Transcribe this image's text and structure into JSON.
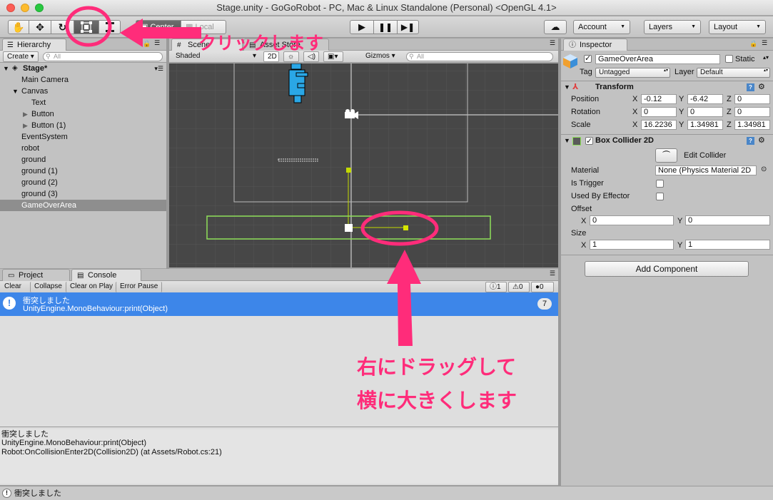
{
  "window": {
    "title": "Stage.unity - GoGoRobot - PC, Mac & Linux Standalone (Personal) <OpenGL 4.1>"
  },
  "toolbar": {
    "pivot_center": "Center",
    "pivot_local": "Local",
    "account": "Account",
    "layers": "Layers",
    "layout": "Layout"
  },
  "hierarchy": {
    "tab": "Hierarchy",
    "create": "Create",
    "search_placeholder": "All",
    "scene_name": "Stage*",
    "items": [
      {
        "label": "Main Camera"
      },
      {
        "label": "Canvas"
      },
      {
        "label": "Text"
      },
      {
        "label": "Button"
      },
      {
        "label": "Button (1)"
      },
      {
        "label": "EventSystem"
      },
      {
        "label": "robot"
      },
      {
        "label": "ground"
      },
      {
        "label": "ground (1)"
      },
      {
        "label": "ground (2)"
      },
      {
        "label": "ground (3)"
      },
      {
        "label": "GameOverArea"
      }
    ]
  },
  "scene": {
    "tab_scene": "Scene",
    "tab_store": "Asset Store",
    "shading": "Shaded",
    "mode_2d": "2D",
    "gizmos": "Gizmos",
    "search_placeholder": "All"
  },
  "console": {
    "tab_project": "Project",
    "tab_console": "Console",
    "clear": "Clear",
    "collapse": "Collapse",
    "clear_on_play": "Clear on Play",
    "error_pause": "Error Pause",
    "count_info": "1",
    "count_warn": "0",
    "count_error": "0",
    "entry_line1": "衝突しました",
    "entry_line2": "UnityEngine.MonoBehaviour:print(Object)",
    "entry_count": "7",
    "detail_line1": "衝突しました",
    "detail_line2": "UnityEngine.MonoBehaviour:print(Object)",
    "detail_line3": "Robot:OnCollisionEnter2D(Collision2D) (at Assets/Robot.cs:21)"
  },
  "inspector": {
    "tab": "Inspector",
    "object_name": "GameOverArea",
    "static_label": "Static",
    "tag_label": "Tag",
    "tag_value": "Untagged",
    "layer_label": "Layer",
    "layer_value": "Default",
    "transform": {
      "title": "Transform",
      "position_label": "Position",
      "rotation_label": "Rotation",
      "scale_label": "Scale",
      "x": "X",
      "y": "Y",
      "z": "Z",
      "position": [
        "-0.12",
        "-6.42",
        "0"
      ],
      "rotation": [
        "0",
        "0",
        "0"
      ],
      "scale": [
        "16.2236",
        "1.34981",
        "1.34981"
      ]
    },
    "collider": {
      "title": "Box Collider 2D",
      "edit_collider": "Edit Collider",
      "material_label": "Material",
      "material_value": "None (Physics Material 2D",
      "is_trigger": "Is Trigger",
      "used_by_effector": "Used By Effector",
      "offset_label": "Offset",
      "offset": [
        "0",
        "0"
      ],
      "size_label": "Size",
      "size": [
        "1",
        "1"
      ]
    },
    "add_component": "Add Component"
  },
  "status": {
    "message": "衝突しました"
  },
  "annotations": {
    "click": "クリックします",
    "drag_line1": "右にドラッグして",
    "drag_line2": "横に大きくします"
  },
  "colors": {
    "annotation": "#ff2c7a",
    "selection": "#3d86e9",
    "collider": "#8fe05a",
    "handle": "#d6e600"
  }
}
